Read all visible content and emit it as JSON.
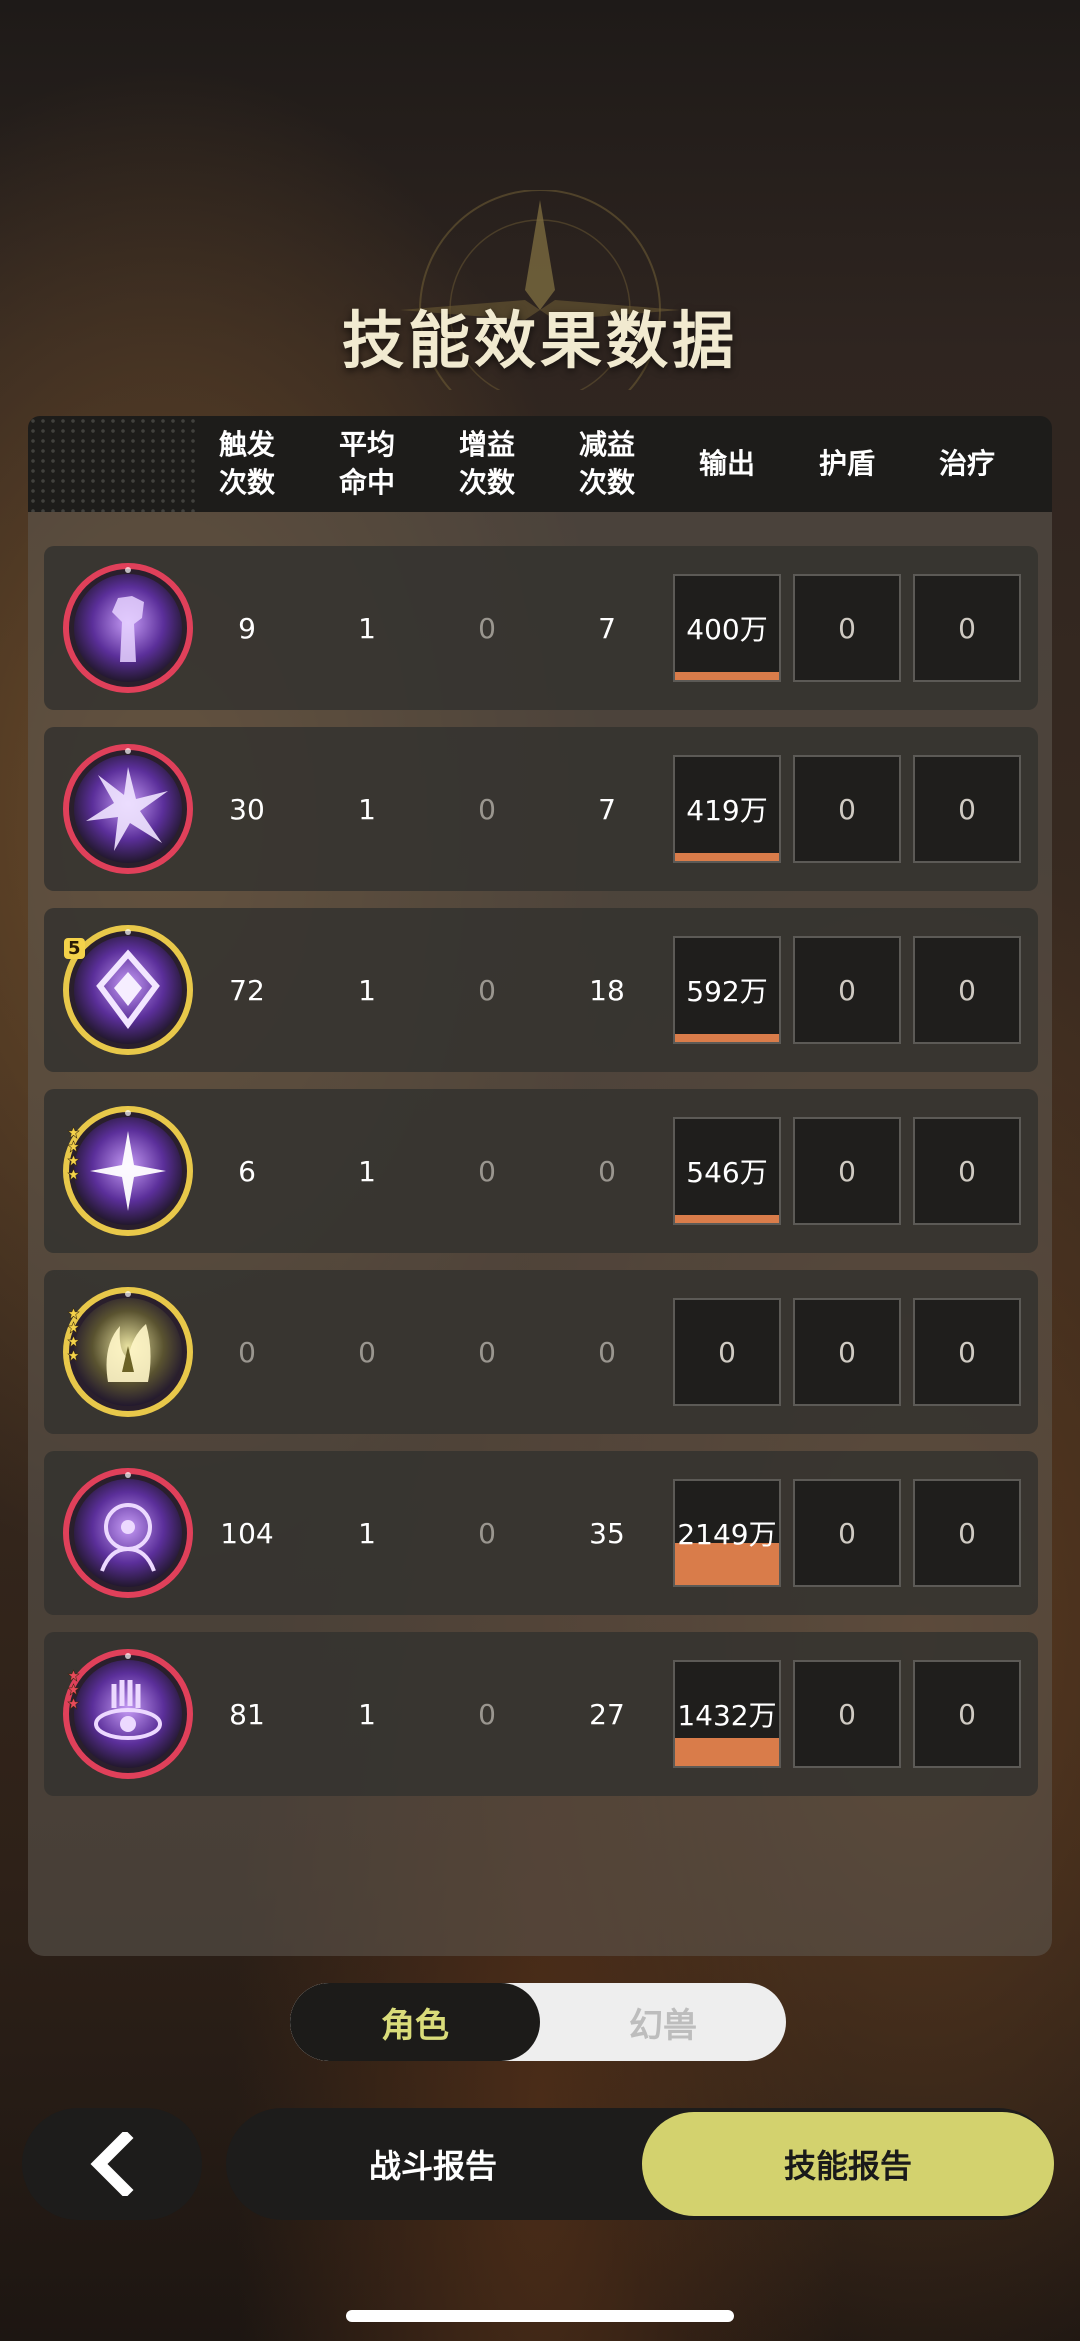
{
  "page": {
    "title": "技能效果数据"
  },
  "table": {
    "headers": [
      {
        "key": "trigger",
        "line1": "触发",
        "line2": "次数"
      },
      {
        "key": "hit",
        "line1": "平均",
        "line2": "命中"
      },
      {
        "key": "buff",
        "line1": "增益",
        "line2": "次数"
      },
      {
        "key": "debuff",
        "line1": "减益",
        "line2": "次数"
      },
      {
        "key": "output",
        "line1": "输出",
        "line2": ""
      },
      {
        "key": "shield",
        "line1": "护盾",
        "line2": ""
      },
      {
        "key": "heal",
        "line1": "治疗",
        "line2": ""
      }
    ],
    "rows": [
      {
        "icon": "purple-fist-skill-icon",
        "ring": "red",
        "stars": 0,
        "trigger": "9",
        "hit": "1",
        "buff": "0",
        "debuff": "7",
        "output": "400万",
        "output_fraction": 0.08,
        "shield": "0",
        "heal": "0"
      },
      {
        "icon": "purple-burst-skill-icon",
        "ring": "red",
        "stars": 0,
        "trigger": "30",
        "hit": "1",
        "buff": "0",
        "debuff": "7",
        "output": "419万",
        "output_fraction": 0.08,
        "shield": "0",
        "heal": "0"
      },
      {
        "icon": "purple-diamond-skill-icon",
        "ring": "gold",
        "stars": 1,
        "star_label": "5",
        "trigger": "72",
        "hit": "1",
        "buff": "0",
        "debuff": "18",
        "output": "592万",
        "output_fraction": 0.08,
        "shield": "0",
        "heal": "0"
      },
      {
        "icon": "purple-star-skill-icon",
        "ring": "gold",
        "stars": 4,
        "trigger": "6",
        "hit": "1",
        "buff": "0",
        "debuff": "0",
        "output": "546万",
        "output_fraction": 0.08,
        "shield": "0",
        "heal": "0"
      },
      {
        "icon": "golden-flame-skill-icon",
        "ring": "gold",
        "stars": 4,
        "trigger": "0",
        "hit": "0",
        "buff": "0",
        "debuff": "0",
        "output": "0",
        "output_fraction": 0,
        "shield": "0",
        "heal": "0"
      },
      {
        "icon": "purple-spirit-skill-icon",
        "ring": "red",
        "stars": 0,
        "trigger": "104",
        "hit": "1",
        "buff": "0",
        "debuff": "35",
        "output": "2149万",
        "output_fraction": 0.4,
        "shield": "0",
        "heal": "0"
      },
      {
        "icon": "purple-eye-skill-icon",
        "ring": "red",
        "stars": 3,
        "trigger": "81",
        "hit": "1",
        "buff": "0",
        "debuff": "27",
        "output": "1432万",
        "output_fraction": 0.27,
        "shield": "0",
        "heal": "0"
      }
    ]
  },
  "toggle": {
    "active": "角色",
    "inactive": "幻兽"
  },
  "nav": {
    "battle_report": "战斗报告",
    "skill_report": "技能报告"
  },
  "colors": {
    "accent": "#d3d26e",
    "output_bar": "#d97c4a",
    "active_text": "#d9dc7a"
  }
}
